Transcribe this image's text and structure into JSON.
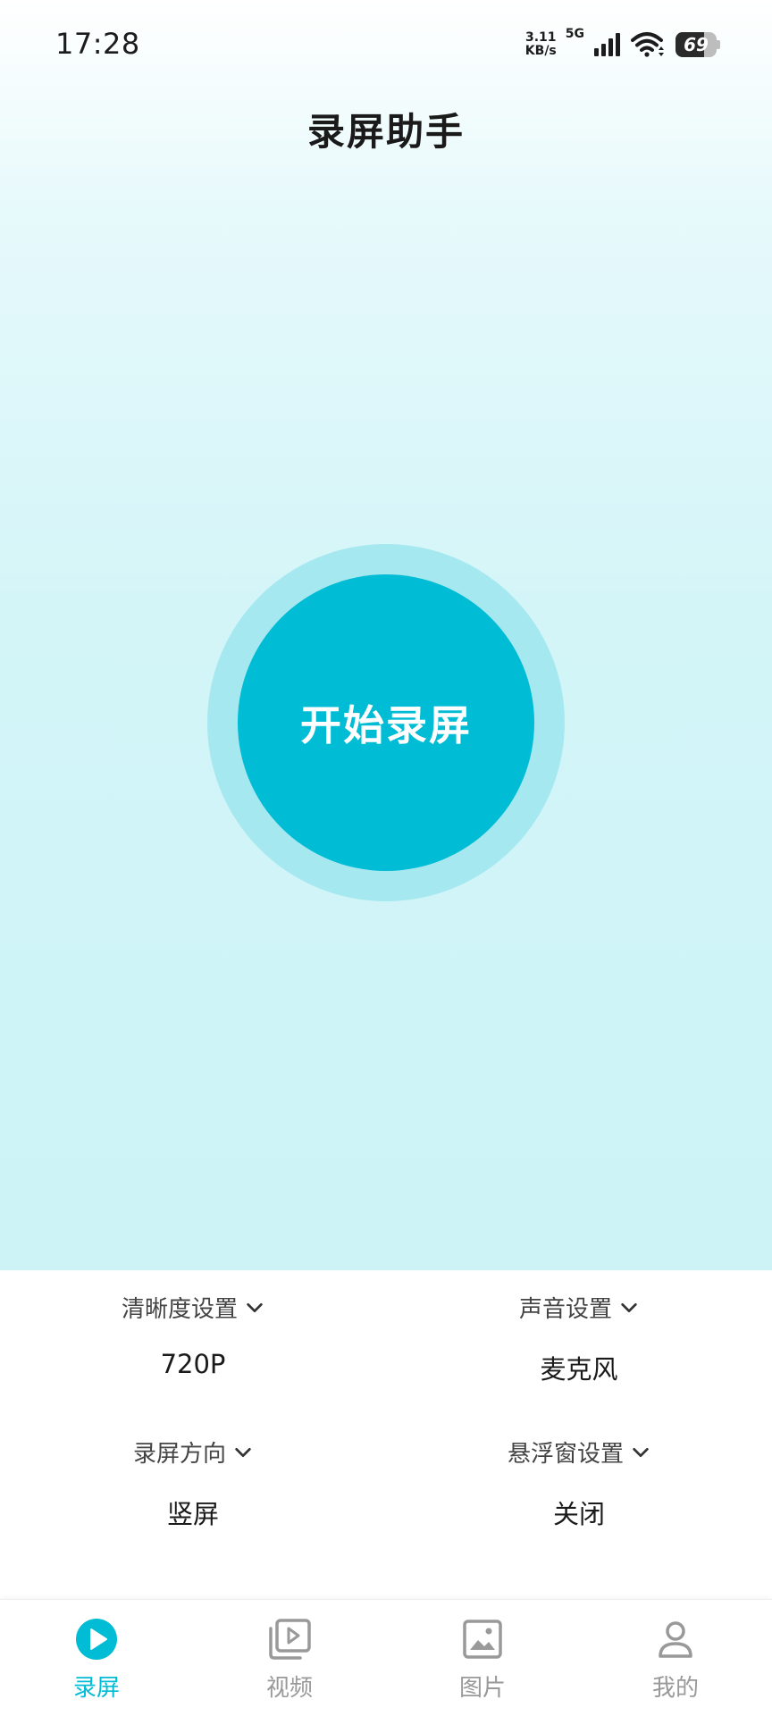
{
  "status_bar": {
    "time": "17:28",
    "net_speed_value": "3.11",
    "net_speed_unit": "KB/s",
    "network_type": "5G",
    "battery_level": "69",
    "battery_fraction": 0.69
  },
  "header": {
    "title": "录屏助手"
  },
  "record_button": {
    "label": "开始录屏"
  },
  "settings": {
    "resolution": {
      "label": "清晰度设置",
      "value": "720P"
    },
    "audio": {
      "label": "声音设置",
      "value": "麦克风"
    },
    "orientation": {
      "label": "录屏方向",
      "value": "竖屏"
    },
    "floating_window": {
      "label": "悬浮窗设置",
      "value": "关闭"
    }
  },
  "bottom_nav": {
    "items": [
      {
        "label": "录屏",
        "icon": "play-circle-icon",
        "active": true
      },
      {
        "label": "视频",
        "icon": "video-library-icon",
        "active": false
      },
      {
        "label": "图片",
        "icon": "image-icon",
        "active": false
      },
      {
        "label": "我的",
        "icon": "person-icon",
        "active": false
      }
    ]
  },
  "colors": {
    "accent": "#00bcd4",
    "accent_light": "#a6e8f0",
    "inactive": "#999999",
    "background_tint": "#cff4f7"
  }
}
